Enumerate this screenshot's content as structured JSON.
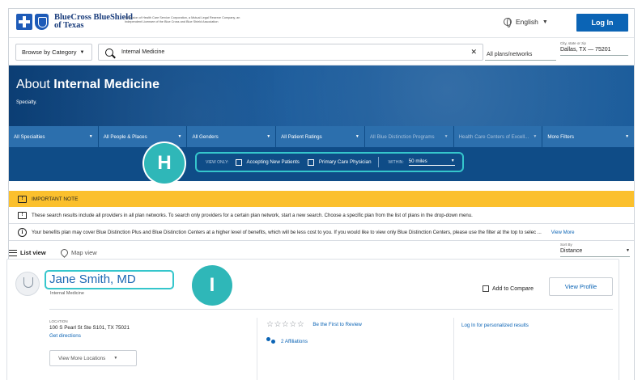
{
  "header": {
    "brand_line1": "BlueCross BlueShield",
    "brand_line2": "of Texas",
    "tagline": "A Division of Health Care Service Corporation, a Mutual Legal Reserve Company, an Independent Licensee of the Blue Cross and Blue Shield Association",
    "language": "English",
    "login_label": "Log In"
  },
  "search": {
    "browse_label": "Browse by Category",
    "query": "Internal Medicine",
    "plans_label": "All plans/networks",
    "location_label": "City, state or zip",
    "location_value": "Dallas, TX — 75201"
  },
  "hero": {
    "title_prefix": "About",
    "title_bold": "Internal Medicine",
    "subtitle": "Specialty."
  },
  "filters": [
    {
      "label": "All Specialties",
      "disabled": false
    },
    {
      "label": "All People & Places",
      "disabled": false
    },
    {
      "label": "All Genders",
      "disabled": false
    },
    {
      "label": "All Patient Ratings",
      "disabled": false
    },
    {
      "label": "All Blue Distinction Programs",
      "disabled": true
    },
    {
      "label": "Health Care Centers of Excell...",
      "disabled": true
    },
    {
      "label": "More Filters",
      "disabled": false
    }
  ],
  "view_only": {
    "label": "VIEW ONLY:",
    "accepting": "Accepting New Patients",
    "primary": "Primary Care Physician",
    "within_label": "WITHIN:",
    "within_value": "50 miles"
  },
  "badges": {
    "h": "H",
    "i": "I"
  },
  "note": {
    "title": "IMPORTANT NOTE",
    "line1": "These search results include all providers in all plan networks. To search only providers for a certain plan network, start a new search. Choose a specific plan from the list of plans in the drop-down menu.",
    "line2": "Your benefits plan may cover Blue Distinction Plus and Blue Distinction Centers at a higher level of benefits, which will be less cost to you. If you would like to view only Blue Distinction Centers, please use the filter at the top to selec ...",
    "view_more": "View More"
  },
  "view": {
    "list_label": "List view",
    "map_label": "Map view",
    "sort_label": "Sort By",
    "sort_value": "Distance"
  },
  "provider": {
    "name": "Jane Smith, MD",
    "specialty": "Internal Medicine",
    "compare_label": "Add to Compare",
    "view_profile": "View Profile",
    "location_label": "LOCATION",
    "address": "100 S Pearl St Ste S101, TX 75021",
    "directions": "Get directions",
    "more_locations": "View More Locations",
    "review_prompt": "Be the First to Review",
    "affiliations": "2 Affiliations",
    "personalized": "Log In for personalized results",
    "stars": "☆☆☆☆☆"
  }
}
